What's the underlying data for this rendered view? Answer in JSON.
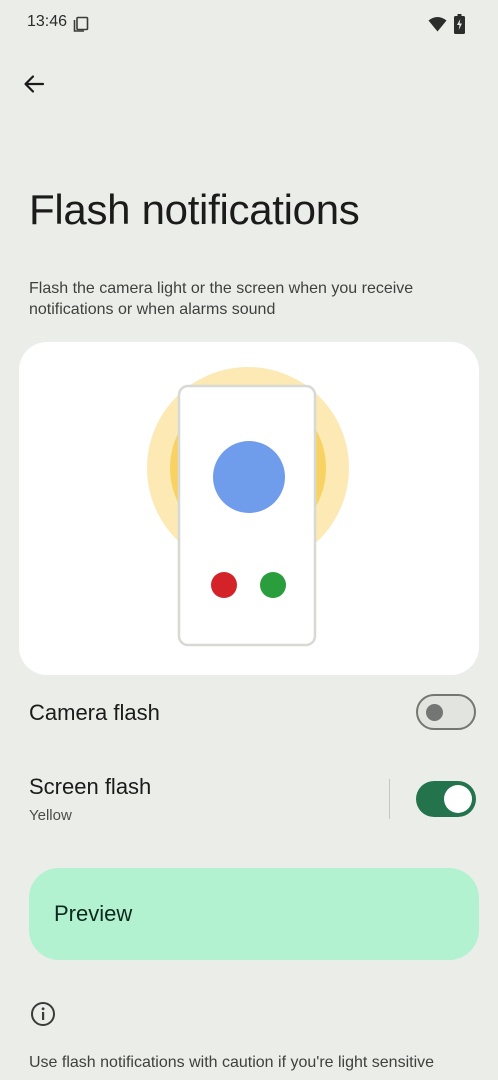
{
  "status_bar": {
    "time": "13:46",
    "icons": [
      "copy-icon",
      "wifi-icon",
      "battery-charging-icon"
    ]
  },
  "nav": {
    "back_icon": "arrow-back-icon"
  },
  "page": {
    "title": "Flash notifications",
    "description": "Flash the camera light or the screen when you receive notifications or when alarms sound"
  },
  "illustration": {
    "glow_color": "#fde9b3",
    "inner_glow_color": "#f8d262",
    "phone_border_color": "#d7d9d5",
    "big_dot_color": "#6f9ceb",
    "red_dot_color": "#d32228",
    "green_dot_color": "#2a9d3c"
  },
  "settings": {
    "camera_flash": {
      "label": "Camera flash",
      "enabled": false
    },
    "screen_flash": {
      "label": "Screen flash",
      "summary": "Yellow",
      "enabled": true
    }
  },
  "preview": {
    "label": "Preview"
  },
  "info": {
    "icon": "info-icon",
    "caution_text": "Use flash notifications with caution if you're light sensitive"
  },
  "colors": {
    "background": "#ebede9",
    "card": "#ffffff",
    "toggle_on": "#23744d",
    "preview_button": "#b2f2d1"
  }
}
